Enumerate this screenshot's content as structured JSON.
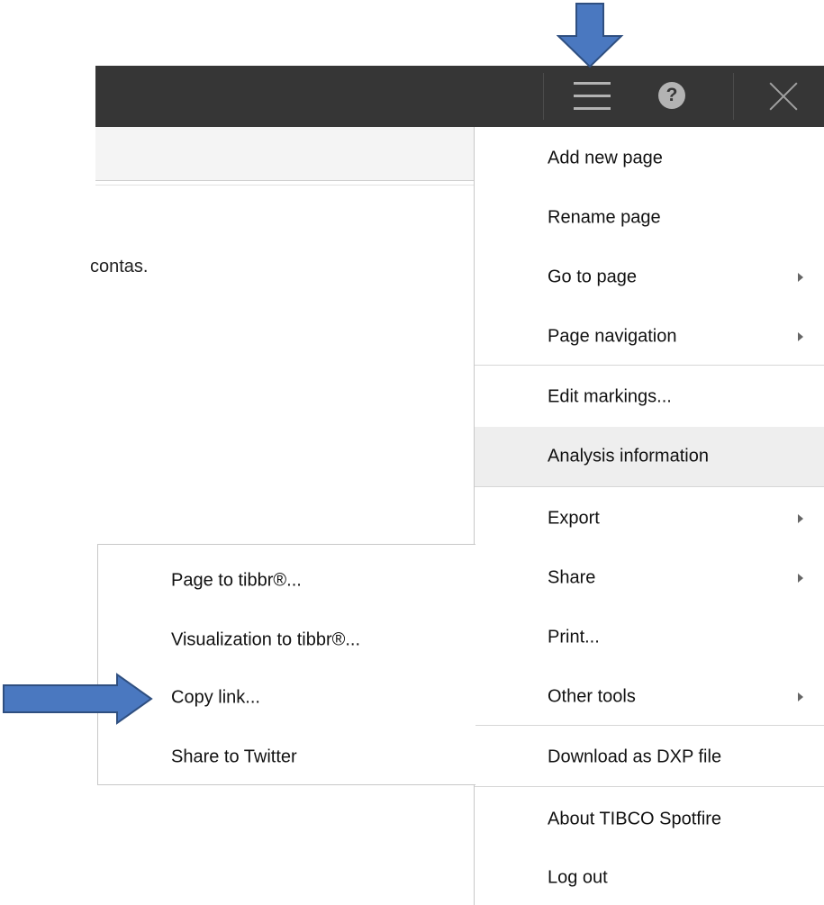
{
  "app": {
    "background_text": "contas.",
    "colors": {
      "toolbar": "#363636",
      "menu_highlight": "#eeeeee",
      "arrow_fill": "#4a78c0",
      "arrow_stroke": "#2f4f80"
    }
  },
  "toolbar": {
    "menu_icon": "hamburger-icon",
    "help_icon": "help-icon",
    "help_glyph": "?",
    "close_icon": "close-icon"
  },
  "main_menu": {
    "items": [
      {
        "label": "Add new page",
        "has_submenu": false
      },
      {
        "label": "Rename page",
        "has_submenu": false
      },
      {
        "label": "Go to page",
        "has_submenu": true
      },
      {
        "label": "Page navigation",
        "has_submenu": true
      },
      {
        "label": "Edit markings...",
        "has_submenu": false
      },
      {
        "label": "Analysis information",
        "has_submenu": false,
        "highlighted": true
      },
      {
        "label": "Export",
        "has_submenu": true
      },
      {
        "label": "Share",
        "has_submenu": true
      },
      {
        "label": "Print...",
        "has_submenu": false
      },
      {
        "label": "Other tools",
        "has_submenu": true
      },
      {
        "label": "Download as DXP file",
        "has_submenu": false
      },
      {
        "label": "About TIBCO Spotfire",
        "has_submenu": false
      },
      {
        "label": "Log out",
        "has_submenu": false
      }
    ]
  },
  "share_menu": {
    "items": [
      {
        "label": "Page to tibbr®..."
      },
      {
        "label": "Visualization to tibbr®..."
      },
      {
        "label": "Copy link..."
      },
      {
        "label": "Share to Twitter"
      }
    ]
  }
}
